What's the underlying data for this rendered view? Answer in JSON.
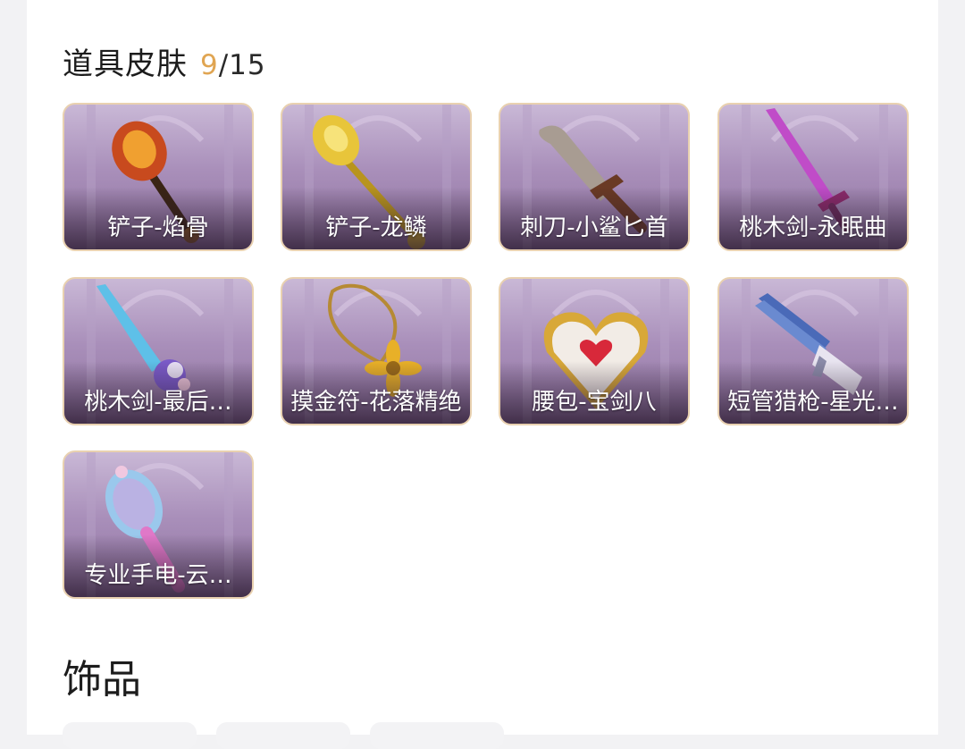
{
  "skins_section": {
    "title": "道具皮肤",
    "count_current": "9",
    "count_total": "/15",
    "items": [
      {
        "label": "铲子-焰骨",
        "icon": "flame-shovel-icon"
      },
      {
        "label": "铲子-龙鳞",
        "icon": "golden-shovel-icon"
      },
      {
        "label": "刺刀-小鲨匕首",
        "icon": "shark-dagger-icon"
      },
      {
        "label": "桃木剑-永眠曲",
        "icon": "pink-sword-icon"
      },
      {
        "label": "桃木剑-最后…",
        "icon": "crystal-sword-icon"
      },
      {
        "label": "摸金符-花落精绝",
        "icon": "flower-amulet-icon"
      },
      {
        "label": "腰包-宝剑八",
        "icon": "heart-pouch-icon"
      },
      {
        "label": "短管猎枪-星光…",
        "icon": "shotgun-icon"
      },
      {
        "label": "专业手电-云…",
        "icon": "flashlight-icon"
      }
    ]
  },
  "accessories_section": {
    "title": "饰品"
  },
  "colors": {
    "accent": "#e0a552",
    "tile_border": "#e9d1b0",
    "tile_bg": "#a98fba"
  }
}
